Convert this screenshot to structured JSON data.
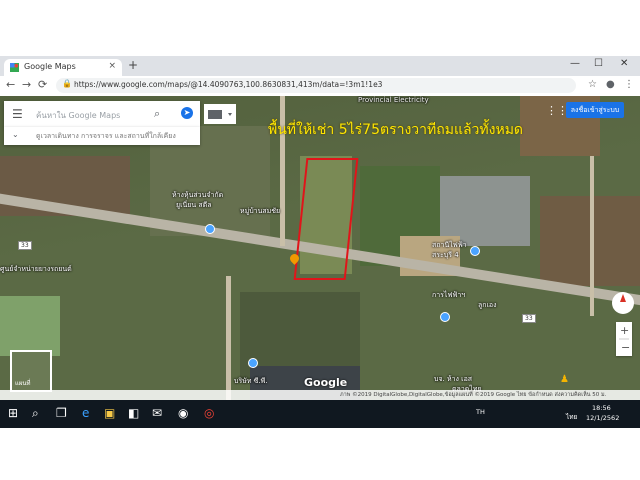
{
  "browser": {
    "tab_title": "Google Maps",
    "tab_close": "×",
    "new_tab": "+",
    "url": "https://www.google.com/maps/@14.4090763,100.8630831,413m/data=!3m1!1e3",
    "minimize": "—",
    "maximize": "☐",
    "close": "✕",
    "back": "←",
    "forward": "→",
    "reload": "⟳",
    "lock": "🔒",
    "star": "☆",
    "account": "●",
    "more": "⋮"
  },
  "search": {
    "menu_icon": "☰",
    "placeholder": "ค้นหาใน Google Maps",
    "search_icon": "⌕",
    "directions_icon": "➤",
    "sub_chevron": "⌄",
    "sub_text": "ดูเวลาเดินทาง การจราจร และสถานที่ใกล้เคียง"
  },
  "header": {
    "signin": "ลงชื่อเข้าสู่ระบบ",
    "apps_icon": "⋮⋮⋮"
  },
  "overlay_text": "พื้นที่ให้เช่า 5ไร่75ตรางวาทีถมแล้วทั้งหมด",
  "map_labels": [
    "Provincial Electricity",
    "ห้างหุ้นส่วนจำกัด",
    "ยูเนี่ยน สตีล",
    "หมู่บ้านสมชัย",
    "สถานีไฟฟ้า",
    "สระบุรี 4",
    "การไฟฟ้าฯ",
    "ลูกเอง",
    "ศูนย์จำหน่ายยางรถยนต์",
    "บริษัท ซี.พี.",
    "บจ. ห้าง เอส",
    "ตลาดไทย"
  ],
  "road_shields": [
    "33",
    "33"
  ],
  "google_logo": "Google",
  "satellite_thumb_label": "แผนที่",
  "attribution": "ภาพ ©2019 DigitalGlobe,DigitalGlobe,ข้อมูลแผนที่ ©2019 Google  ไทย  ข้อกำหนด  ส่งความคิดเห็น  50 ม.",
  "taskbar": {
    "start": "⊞",
    "search": "⌕",
    "taskview": "❐",
    "edge": "e",
    "explorer": "▣",
    "store": "◧",
    "mail": "✉",
    "media": "◉",
    "chrome": "◎",
    "lang": "TH",
    "time": "18:56",
    "date": "12/1/2562",
    "tray_lang": "ไทย"
  }
}
